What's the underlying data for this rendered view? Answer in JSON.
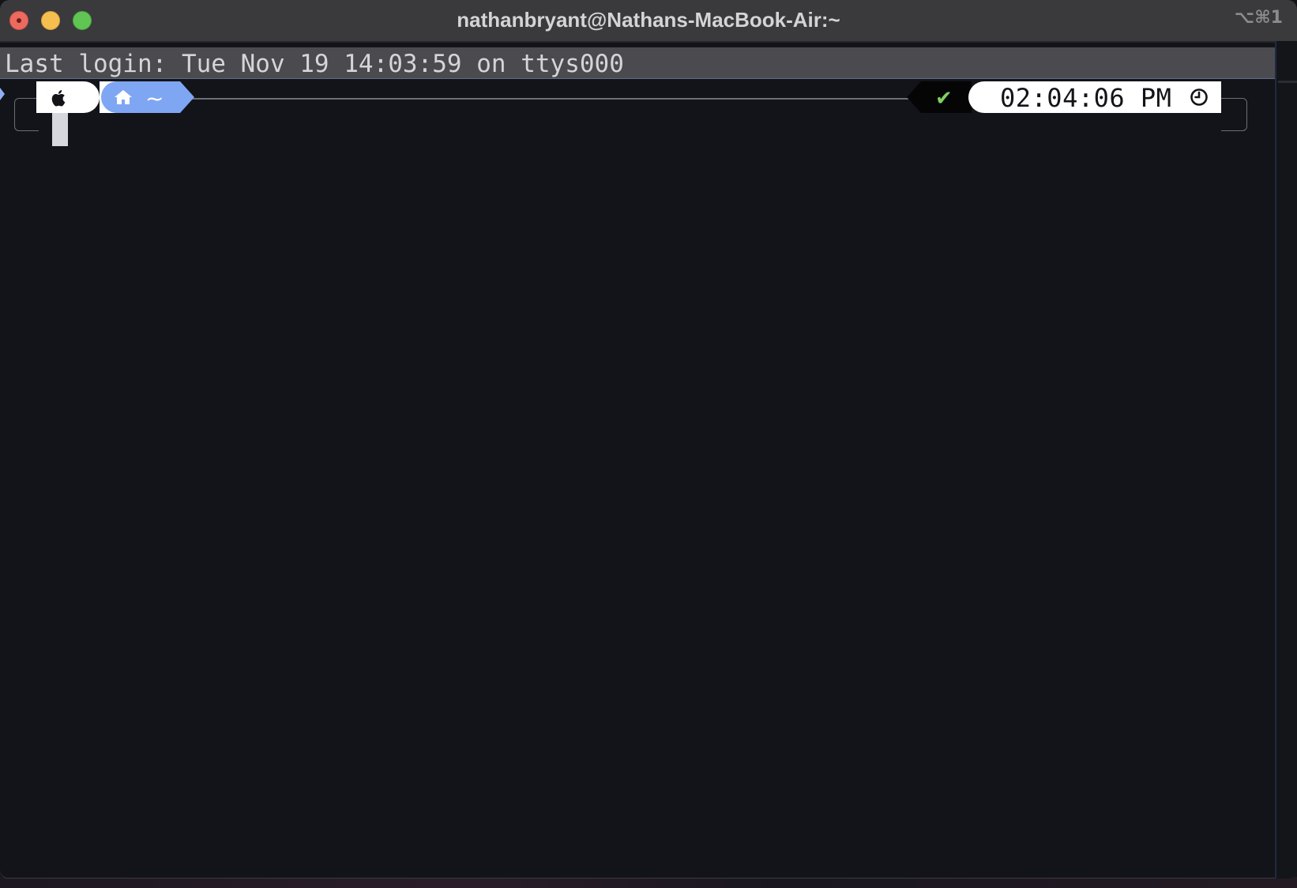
{
  "window": {
    "title": "nathanbryant@Nathans-MacBook-Air:~",
    "shortcut": "⌥⌘1",
    "traffic_lights": [
      "close-button",
      "minimize-button",
      "zoom-button"
    ]
  },
  "terminal": {
    "last_login": "Last login: Tue Nov 19 14:03:59 on ttys000",
    "prompt": {
      "os_icon": "apple-icon",
      "dir_icon": "home-icon",
      "directory": "~",
      "status_icon": "check-icon",
      "status_symbol": "✔",
      "time": "02:04:06 PM",
      "time_icon": "clock-icon"
    }
  },
  "colors": {
    "terminal_bg": "#131419",
    "dir_segment": "#7ea6f2",
    "status_ok": "#7fd160",
    "titlebar": "#3a3a3d"
  }
}
